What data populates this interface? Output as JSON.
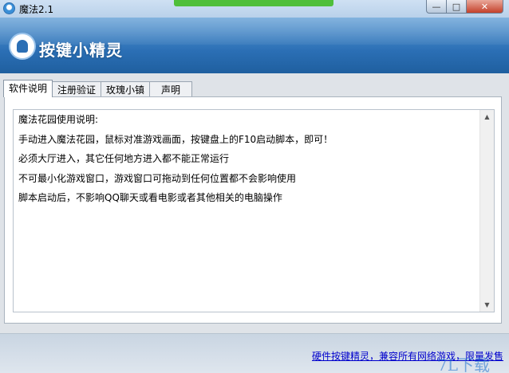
{
  "window": {
    "title": "魔法2.1"
  },
  "titlebar_buttons": {
    "minimize": "—",
    "maximize": "□",
    "close": "✕"
  },
  "banner": {
    "brand": "按键小精灵"
  },
  "tabs": [
    {
      "label": "软件说明",
      "active": true
    },
    {
      "label": "注册验证",
      "active": false
    },
    {
      "label": "玫瑰小镇",
      "active": false
    },
    {
      "label": "声明",
      "active": false
    }
  ],
  "content": {
    "lines": [
      "魔法花园使用说明:",
      "手动进入魔法花园，鼠标对准游戏画面，按键盘上的F10启动脚本，即可！",
      "必须大厅进入，其它任何地方进入都不能正常运行",
      "不可最小化游戏窗口，游戏窗口可拖动到任何位置都不会影响使用",
      "脚本启动后，不影响QQ聊天或看电影或者其他相关的电脑操作"
    ]
  },
  "scrollbar": {
    "up": "▲",
    "down": "▼"
  },
  "footer": {
    "link_text": "硬件按键精灵，兼容所有网络游戏，限量发售",
    "watermark": "7L下载"
  },
  "colors": {
    "banner": "#2b6fb5",
    "link": "#0000cc",
    "close_button": "#c4402a"
  }
}
